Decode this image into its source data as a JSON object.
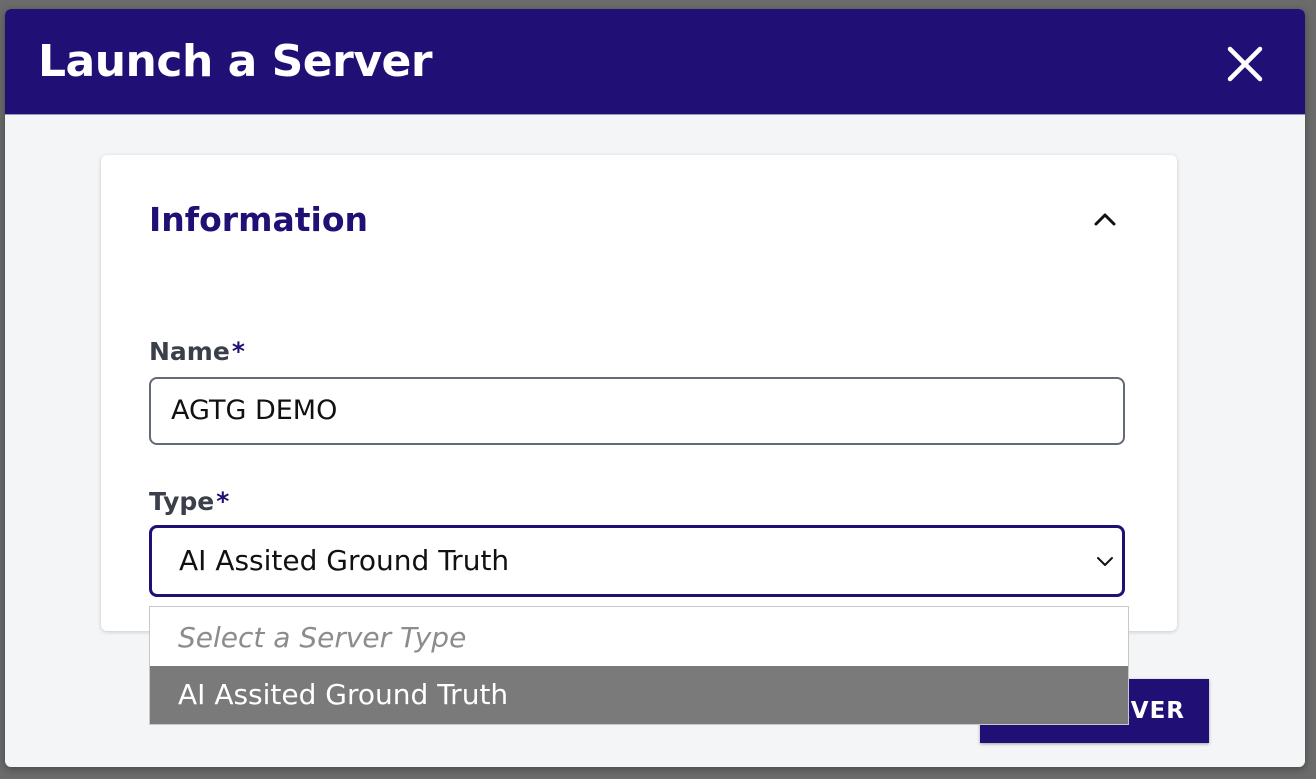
{
  "modal": {
    "title": "Launch a Server"
  },
  "section": {
    "title": "Information"
  },
  "fields": {
    "name": {
      "label": "Name",
      "required_mark": "*",
      "value": "AGTG DEMO"
    },
    "type": {
      "label": "Type",
      "required_mark": "*",
      "value": "AI Assited Ground Truth"
    }
  },
  "dropdown": {
    "options": [
      {
        "label": "Select a Server Type",
        "placeholder": true
      },
      {
        "label": "AI Assited Ground Truth",
        "highlighted": true
      }
    ]
  },
  "submit_button": {
    "visible_label": "RVER"
  },
  "icons": {
    "close": "close-icon",
    "collapse": "chevron-up-icon",
    "select": "chevron-down-icon"
  },
  "colors": {
    "brand": "#200f74",
    "background": "#f4f5f7",
    "highlight": "#7a7a7a"
  }
}
